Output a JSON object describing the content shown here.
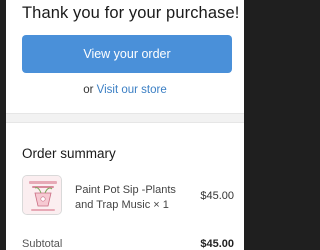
{
  "header": {
    "title": "Thank you for your purchase!"
  },
  "actions": {
    "view_order_label": "View your order",
    "or_text": "or",
    "visit_store_label": "Visit our store"
  },
  "summary": {
    "title": "Order summary",
    "items": [
      {
        "name": "Paint Pot Sip -Plants and Trap Music × 1",
        "price": "$45.00",
        "thumbnail_icon": "event-poster-thumbnail-icon"
      }
    ],
    "subtotal_label": "Subtotal",
    "subtotal_value": "$45.00"
  },
  "colors": {
    "accent": "#4a90d9",
    "link": "#3b7fc4",
    "text": "#1a1a1a",
    "bezel": "#1f1f1f"
  }
}
